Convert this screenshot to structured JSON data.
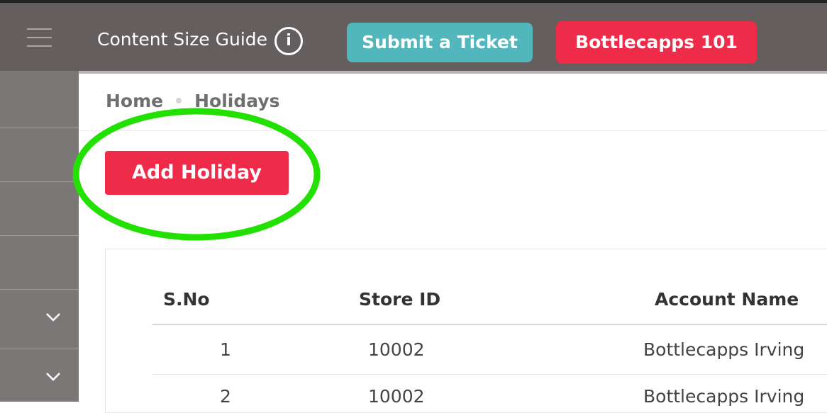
{
  "header": {
    "menu_icon": "hamburger-menu-icon",
    "content_size_guide": "Content Size Guide",
    "info_icon": "info-icon",
    "info_glyph": "i",
    "submit_ticket": "Submit a Ticket",
    "bottlecapps_101": "Bottlecapps 101",
    "colors": {
      "bar": "#645e5e",
      "ticket_button": "#52b6bd",
      "primary_button": "#ee2c4a"
    }
  },
  "sidebar": {
    "items": [
      {
        "icon": ""
      },
      {
        "icon": ""
      },
      {
        "icon": ""
      },
      {
        "icon": ""
      },
      {
        "icon": "chevron-down-icon"
      },
      {
        "icon": "chevron-down-icon"
      }
    ]
  },
  "breadcrumb": {
    "home": "Home",
    "current": "Holidays"
  },
  "actions": {
    "add_holiday": "Add Holiday",
    "highlight_color": "#22e000"
  },
  "table": {
    "columns": [
      "S.No",
      "Store ID",
      "Account Name"
    ],
    "rows": [
      {
        "sno": "1",
        "store_id": "10002",
        "account_name": "Bottlecapps Irving"
      },
      {
        "sno": "2",
        "store_id": "10002",
        "account_name": "Bottlecapps Irving"
      }
    ]
  }
}
